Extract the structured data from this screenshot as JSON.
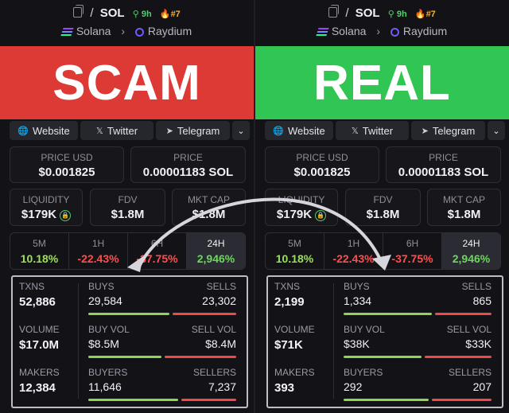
{
  "panels": [
    {
      "id": "left",
      "header": {
        "symbol": "SOL",
        "age": "9h",
        "rank": "#7",
        "chain": "Solana",
        "dex": "Raydium"
      },
      "banner": "SCAM",
      "socials": [
        "Website",
        "Twitter",
        "Telegram"
      ],
      "price_usd": {
        "label": "PRICE USD",
        "value": "$0.001825"
      },
      "price": {
        "label": "PRICE",
        "value": "0.00001183 SOL"
      },
      "liquidity": {
        "label": "LIQUIDITY",
        "value": "$179K"
      },
      "fdv": {
        "label": "FDV",
        "value": "$1.8M"
      },
      "mktcap": {
        "label": "MKT CAP",
        "value": "$1.8M"
      },
      "changes": [
        {
          "label": "5M",
          "value": "10.18%"
        },
        {
          "label": "1H",
          "value": "-22.43%"
        },
        {
          "label": "6H",
          "value": "-37.75%"
        },
        {
          "label": "24H",
          "value": "2,946%"
        }
      ],
      "txns": {
        "label": "TXNS",
        "value": "52,886"
      },
      "volume": {
        "label": "VOLUME",
        "value": "$17.0M"
      },
      "makers": {
        "label": "MAKERS",
        "value": "12,384"
      },
      "buys": {
        "label": "BUYS",
        "value": "29,584"
      },
      "sells": {
        "label": "SELLS",
        "value": "23,302"
      },
      "buy_vol": {
        "label": "BUY VOL",
        "value": "$8.5M"
      },
      "sell_vol": {
        "label": "SELL VOL",
        "value": "$8.4M"
      },
      "buyers": {
        "label": "BUYERS",
        "value": "11,646"
      },
      "sellers": {
        "label": "SELLERS",
        "value": "7,237"
      },
      "bar_buy_fraction": {
        "txns": 0.56,
        "vol": 0.503,
        "makers": 0.617
      }
    },
    {
      "id": "right",
      "header": {
        "symbol": "SOL",
        "age": "9h",
        "rank": "#7",
        "chain": "Solana",
        "dex": "Raydium"
      },
      "banner": "REAL",
      "socials": [
        "Website",
        "Twitter",
        "Telegram"
      ],
      "price_usd": {
        "label": "PRICE USD",
        "value": "$0.001825"
      },
      "price": {
        "label": "PRICE",
        "value": "0.00001183 SOL"
      },
      "liquidity": {
        "label": "LIQUIDITY",
        "value": "$179K"
      },
      "fdv": {
        "label": "FDV",
        "value": "$1.8M"
      },
      "mktcap": {
        "label": "MKT CAP",
        "value": "$1.8M"
      },
      "changes": [
        {
          "label": "5M",
          "value": "10.18%"
        },
        {
          "label": "1H",
          "value": "-22.43%"
        },
        {
          "label": "6H",
          "value": "-37.75%"
        },
        {
          "label": "24H",
          "value": "2,946%"
        }
      ],
      "txns": {
        "label": "TXNS",
        "value": "2,199"
      },
      "volume": {
        "label": "VOLUME",
        "value": "$71K"
      },
      "makers": {
        "label": "MAKERS",
        "value": "393"
      },
      "buys": {
        "label": "BUYS",
        "value": "1,334"
      },
      "sells": {
        "label": "SELLS",
        "value": "865"
      },
      "buy_vol": {
        "label": "BUY VOL",
        "value": "$38K"
      },
      "sell_vol": {
        "label": "SELL VOL",
        "value": "$33K"
      },
      "buyers": {
        "label": "BUYERS",
        "value": "292"
      },
      "sellers": {
        "label": "SELLERS",
        "value": "207"
      },
      "bar_buy_fraction": {
        "txns": 0.607,
        "vol": 0.535,
        "makers": 0.585
      }
    }
  ],
  "colors": {
    "scam": "#de3a35",
    "real": "#31c553",
    "positive": "#9be05a",
    "negative": "#ff4d4d"
  }
}
